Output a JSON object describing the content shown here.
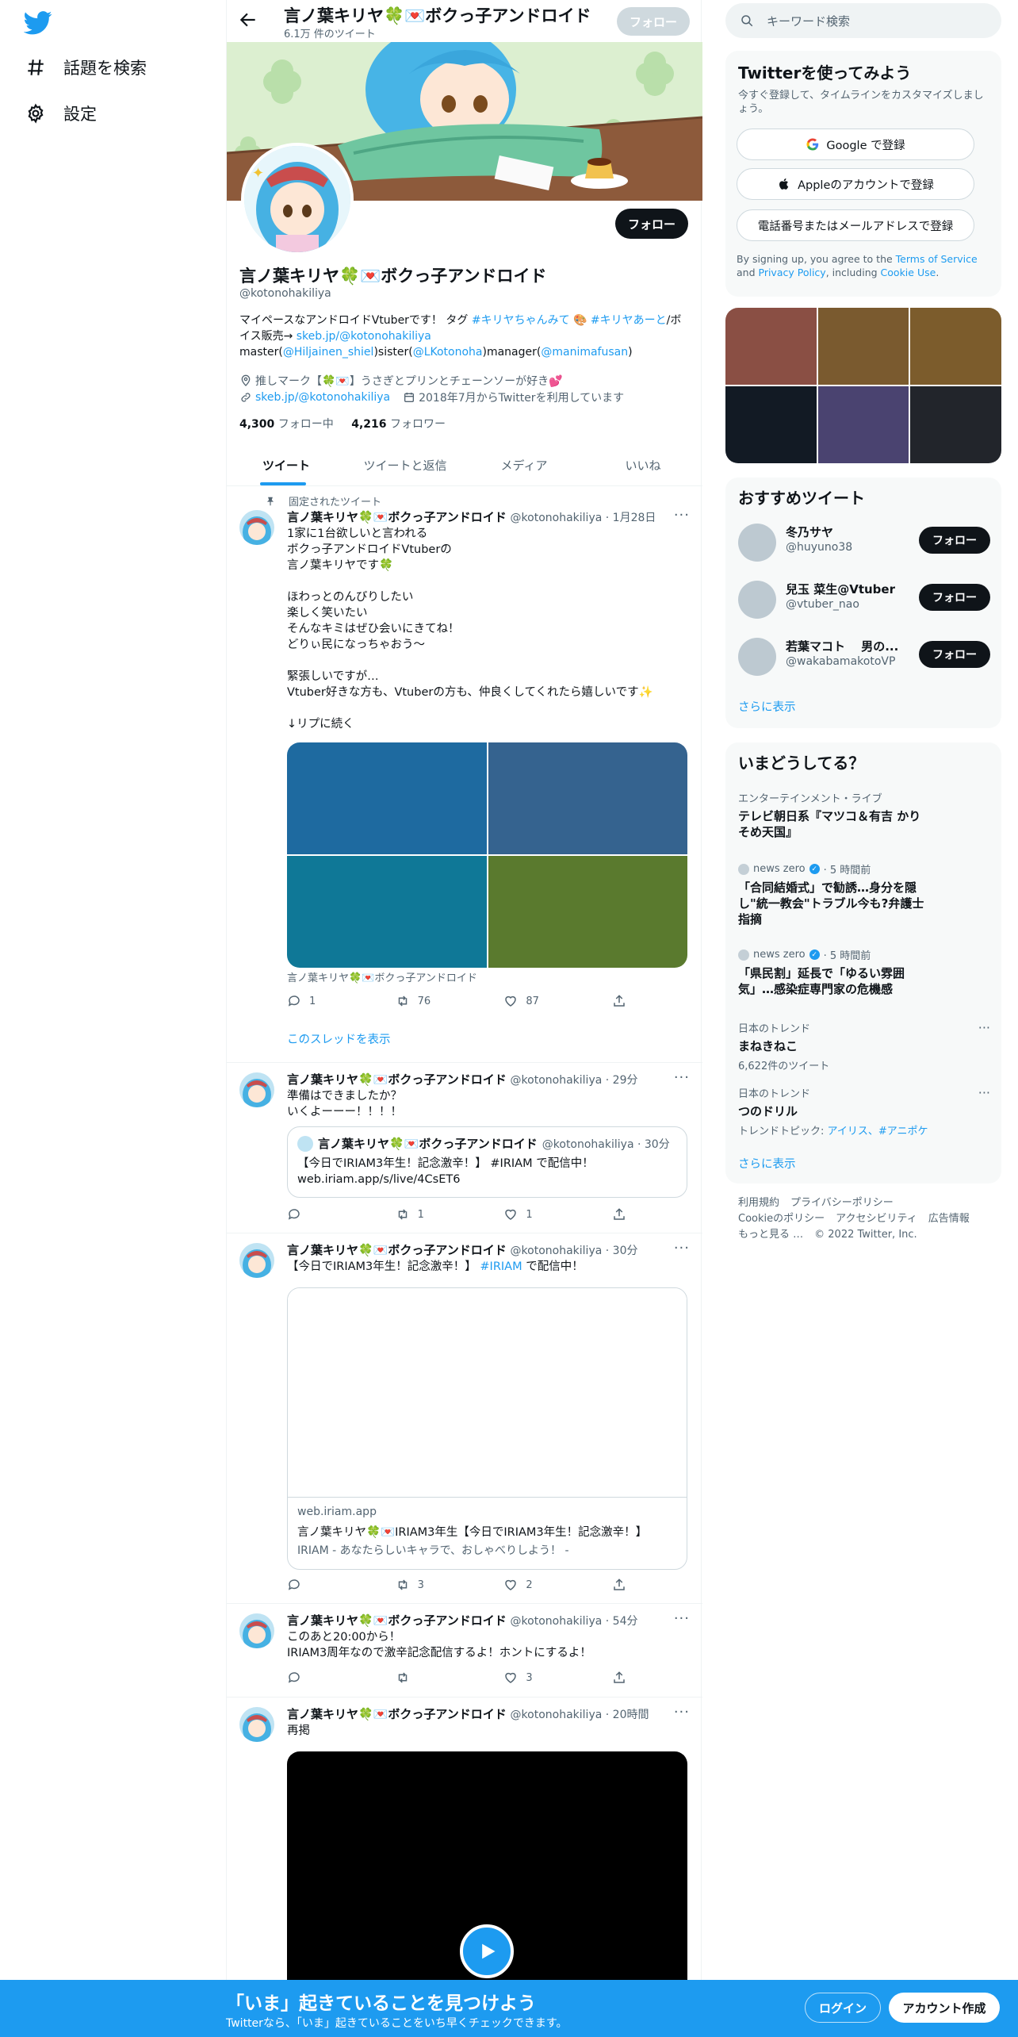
{
  "colors": {
    "accent": "#1d9bf0",
    "text": "#0f1419",
    "muted": "#536471",
    "banner_bottom": "#1d9bf0"
  },
  "sidebar": {
    "items": [
      {
        "label": "話題を検索",
        "icon": "hashtag-icon"
      },
      {
        "label": "設定",
        "icon": "gear-icon"
      }
    ]
  },
  "header": {
    "name": "言ノ葉キリヤ🍀💌ボクっ子アンドロイド",
    "tweet_count": "6.1万 件のツイート",
    "follow_label": "フォロー"
  },
  "profile": {
    "name": "言ノ葉キリヤ🍀💌ボクっ子アンドロイド",
    "handle": "@kotonohakiliya",
    "follow_label": "フォロー",
    "bio_line1_a": "マイペースなアンドロイドVtuberです！ タグ ",
    "bio_tag1": "#キリヤちゃんみて",
    "bio_line1_b": " 🎨 ",
    "bio_tag2": "#キリヤあーと",
    "bio_line2_a": "/ボイス販売→ ",
    "bio_link": "skeb.jp/@kotonohakiliya",
    "bio_line2_b": " master(",
    "bio_master": "@Hiljainen_shiel",
    "bio_line2_c": ")sister(",
    "bio_sister": "@LKotonoha",
    "bio_line3_a": ")manager(",
    "bio_manager": "@manimafusan",
    "bio_line3_b": ")",
    "location": "推しマーク【🍀💌】うさぎとプリンとチェーンソーが好き💕",
    "website": "skeb.jp/@kotonohakiliya",
    "joined": "2018年7月からTwitterを利用しています",
    "following_count": "4,300",
    "following_label": "フォロー中",
    "followers_count": "4,216",
    "followers_label": "フォロワー"
  },
  "tabs": [
    "ツイート",
    "ツイートと返信",
    "メディア",
    "いいね"
  ],
  "tweets": [
    {
      "pinned_label": "固定されたツイート",
      "name": "言ノ葉キリヤ🍀💌ボクっ子アンドロイド",
      "meta": "@kotonohakiliya · 1月28日",
      "text": "1家に1台欲しいと言われる\nボクっ子アンドロイドVtuberの\n言ノ葉キリヤです🍀\n\nほわっとのんびりしたい\n楽しく笑いたい\nそんなキミはぜひ会いにきてね！\nどりぃ民になっちゃおう～\n\n緊張しいですが…\nVtuber好きな方も、Vtuberの方も、仲良くしてくれたら嬉しいです✨\n\n↓リプに続く",
      "media_colors": [
        "#1e6aa0",
        "#35638f",
        "#0f7897",
        "#5a7a2e"
      ],
      "media_caption": "言ノ葉キリヤ🍀💌ボクっ子アンドロイド",
      "replies": "1",
      "retweets": "76",
      "likes": "87",
      "thread_label": "このスレッドを表示"
    },
    {
      "name": "言ノ葉キリヤ🍀💌ボクっ子アンドロイド",
      "meta": "@kotonohakiliya · 29分",
      "text": "準備はできましたか？\nいくよーーー！！！！",
      "quote_name": "言ノ葉キリヤ🍀💌ボクっ子アンドロイド",
      "quote_meta": "@kotonohakiliya · 30分",
      "quote_text": "【今日でIRIAM3年生！記念激辛！】 #IRIAM で配信中！\nweb.iriam.app/s/live/4CsET6",
      "replies": "",
      "retweets": "1",
      "likes": "1"
    },
    {
      "name": "言ノ葉キリヤ🍀💌ボクっ子アンドロイド",
      "meta": "@kotonohakiliya · 30分",
      "text_a": "【今日でIRIAM3年生！記念激辛！】 ",
      "text_tag": "#IRIAM",
      "text_b": " で配信中！",
      "card_domain": "web.iriam.app",
      "card_title": "言ノ葉キリヤ🍀💌IRIAM3年生【今日でIRIAM3年生！記念激辛！】",
      "card_desc": "IRIAM - あなたらしいキャラで、おしゃべりしよう！ -",
      "replies": "",
      "retweets": "3",
      "likes": "2"
    },
    {
      "name": "言ノ葉キリヤ🍀💌ボクっ子アンドロイド",
      "meta": "@kotonohakiliya · 54分",
      "text": "このあと20:00から！\nIRIAM3周年なので激辛記念配信するよ！ホントにするよ！",
      "replies": "",
      "retweets": "",
      "likes": "3"
    },
    {
      "name": "言ノ葉キリヤ🍀💌ボクっ子アンドロイド",
      "meta": "@kotonohakiliya · 20時間",
      "text": "再掲"
    }
  ],
  "right": {
    "search_placeholder": "キーワード検索",
    "signup": {
      "title": "Twitterを使ってみよう",
      "subtitle": "今すぐ登録して、タイムラインをカスタマイズしましょう。",
      "google": "Google で登録",
      "apple": "Appleのアカウントで登録",
      "phone": "電話番号またはメールアドレスで登録",
      "terms_a": "By signing up, you agree to the ",
      "terms_link1": "Terms of Service",
      "terms_b": " and ",
      "terms_link2": "Privacy Policy",
      "terms_c": ", including ",
      "terms_link3": "Cookie Use",
      "terms_d": "."
    },
    "photo_colors": [
      "#8a4f44",
      "#7a5a2f",
      "#7c5c2c",
      "#121a24",
      "#4a4370",
      "#22252b"
    ],
    "recommend": {
      "title": "おすすめツイート",
      "users": [
        {
          "name": "冬乃サヤ",
          "handle": "@huyuno38"
        },
        {
          "name": "兒玉 菜生@Vtuber",
          "handle": "@vtuber_nao"
        },
        {
          "name": "若葉マコト　 男の...",
          "handle": "@wakabamakotoVP"
        }
      ],
      "follow_label": "フォロー",
      "more": "さらに表示"
    },
    "trends": {
      "title": "いまどうしてる？",
      "items": [
        {
          "category": "エンターテインメント・ライブ",
          "title": "テレビ朝日系『マツコ＆有吉 かりそめ天国』"
        },
        {
          "source": "news zero",
          "time": "· 5 時間前",
          "title": "「合同結婚式」で勧誘…身分を隠し\"統一教会\"トラブル今も?弁護士指摘"
        },
        {
          "source": "news zero",
          "time": "· 5 時間前",
          "title": "「県民割」延長で「ゆるい雰囲気」…感染症専門家の危機感"
        },
        {
          "category": "日本のトレンド",
          "title": "まねきねこ",
          "count": "6,622件のツイート"
        },
        {
          "category": "日本のトレンド",
          "title": "つのドリル",
          "topic_label": "トレンドトピック: ",
          "topic_links": "アイリス、#アニポケ"
        }
      ],
      "more": "さらに表示"
    },
    "footer": [
      "利用規約",
      "プライバシーポリシー",
      "Cookieのポリシー",
      "アクセシビリティ",
      "広告情報",
      "もっと見る …",
      "© 2022 Twitter, Inc."
    ]
  },
  "bottom_banner": {
    "title": "「いま」起きていることを見つけよう",
    "subtitle": "Twitterなら、「いま」起きていることをいち早くチェックできます。",
    "login": "ログイン",
    "signup": "アカウント作成"
  }
}
